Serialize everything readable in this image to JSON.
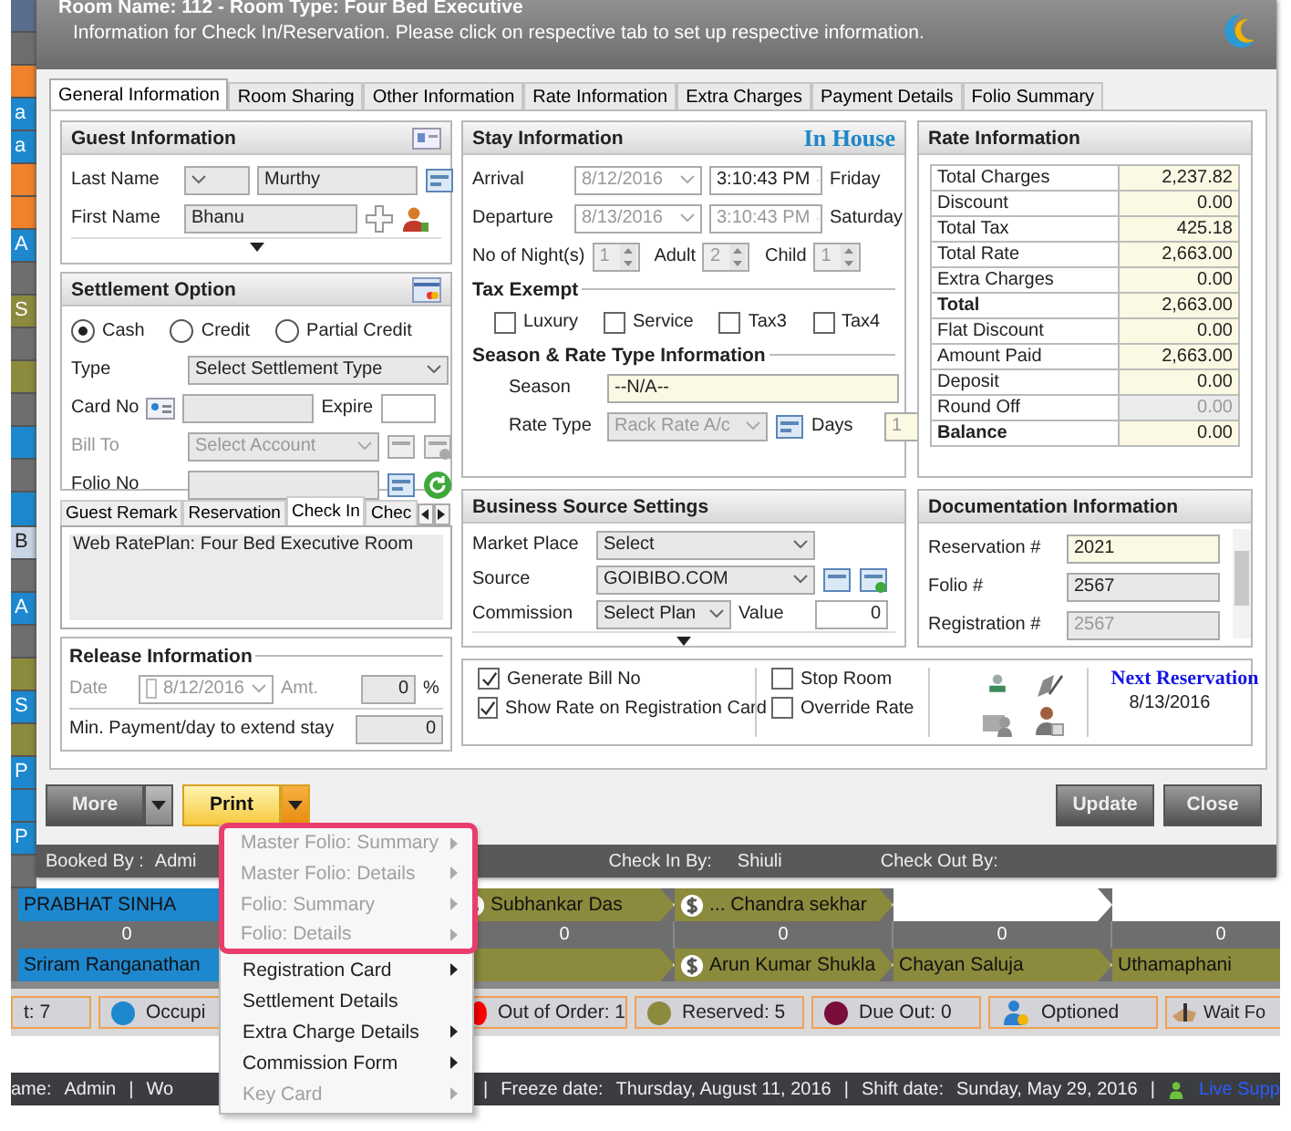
{
  "window": {
    "title": "Room Name: 112 - Room Type: Four Bed Executive",
    "subtitle": "Information for Check In/Reservation. Please click on respective tab to set up respective information."
  },
  "tabs": [
    {
      "label": "General Information",
      "selected": true
    },
    {
      "label": "Room Sharing",
      "selected": false
    },
    {
      "label": "Other Information",
      "selected": false
    },
    {
      "label": "Rate Information",
      "selected": false
    },
    {
      "label": "Extra Charges",
      "selected": false
    },
    {
      "label": "Payment Details",
      "selected": false
    },
    {
      "label": "Folio Summary",
      "selected": false
    }
  ],
  "guest": {
    "title": "Guest Information",
    "last_name_label": "Last Name",
    "last_name": "Murthy",
    "first_name_label": "First Name",
    "first_name": "Bhanu"
  },
  "settlement": {
    "title": "Settlement Option",
    "modes": [
      {
        "label": "Cash",
        "selected": true
      },
      {
        "label": "Credit",
        "selected": false
      },
      {
        "label": "Partial Credit",
        "selected": false
      }
    ],
    "type_label": "Type",
    "type_value": "Select Settlement Type",
    "card_label": "Card No",
    "expire_label": "Expire",
    "bill_to_label": "Bill To",
    "bill_to_value": "Select Account",
    "bill_to_disabled": true,
    "folio_label": "Folio No"
  },
  "remarks": {
    "tabs": [
      {
        "label": "Guest Remark",
        "selected": false
      },
      {
        "label": "Reservation",
        "selected": false
      },
      {
        "label": "Check In",
        "selected": true
      },
      {
        "label": "Chec",
        "selected": false
      }
    ],
    "text": "Web RatePlan: Four Bed Executive Room"
  },
  "release": {
    "title": "Release Information",
    "date_label": "Date",
    "date": "8/12/2016",
    "amount_label": "Amt.",
    "amount": "0",
    "percent": "%",
    "min_payment_label": "Min. Payment/day to extend stay",
    "min_payment": "0"
  },
  "stay": {
    "title": "Stay Information",
    "status": "In House",
    "dates": [
      {
        "label": "Arrival",
        "date": "8/12/2016",
        "time": "3:10:43 PM",
        "time_disabled": false,
        "day": "Friday"
      },
      {
        "label": "Departure",
        "date": "8/13/2016",
        "time": "3:10:43 PM",
        "time_disabled": true,
        "day": "Saturday"
      }
    ],
    "counts": [
      {
        "label": "No of Night(s)",
        "value": "1"
      },
      {
        "label": "Adult",
        "value": "2"
      },
      {
        "label": "Child",
        "value": "1"
      }
    ],
    "tax_title": "Tax Exempt",
    "taxes": [
      {
        "label": "Luxury",
        "checked": false
      },
      {
        "label": "Service",
        "checked": false
      },
      {
        "label": "Tax3",
        "checked": false
      },
      {
        "label": "Tax4",
        "checked": false
      }
    ],
    "season_title": "Season & Rate Type Information",
    "season_label": "Season",
    "season": "--N/A--",
    "rate_type_label": "Rate Type",
    "rate_type": "Rack Rate A/c",
    "days_label": "Days",
    "days": "1"
  },
  "rates": {
    "title": "Rate Information",
    "rows": [
      {
        "label": "Total Charges",
        "value": "2,237.82",
        "kind": "item"
      },
      {
        "label": "Discount",
        "value": "0.00",
        "kind": "item"
      },
      {
        "label": "Total Tax",
        "value": "425.18",
        "kind": "item"
      },
      {
        "label": "Total Rate",
        "value": "2,663.00",
        "kind": "item"
      },
      {
        "label": "Extra Charges",
        "value": "0.00",
        "kind": "item"
      },
      {
        "label": "Total",
        "value": "2,663.00",
        "kind": "total"
      },
      {
        "label": "Flat Discount",
        "value": "0.00",
        "kind": "item"
      },
      {
        "label": "Amount Paid",
        "value": "2,663.00",
        "kind": "item"
      },
      {
        "label": "Deposit",
        "value": "0.00",
        "kind": "item"
      },
      {
        "label": "Round Off",
        "value": "0.00",
        "kind": "readonly"
      },
      {
        "label": "Balance",
        "value": "0.00",
        "kind": "total"
      }
    ]
  },
  "business": {
    "title": "Business Source Settings",
    "market_label": "Market Place",
    "market": "Select",
    "source_label": "Source",
    "source": "GOIBIBO.COM",
    "commission_label": "Commission",
    "commission": "Select Plan",
    "value_label": "Value",
    "value": "0"
  },
  "documentation": {
    "title": "Documentation Information",
    "rows": [
      {
        "label": "Reservation #",
        "value": "2021",
        "disabled": false
      },
      {
        "label": "Folio #",
        "value": "2567",
        "disabled": false
      },
      {
        "label": "Registration #",
        "value": "2567",
        "disabled": true
      }
    ]
  },
  "options": [
    {
      "label": "Generate Bill No",
      "checked": true
    },
    {
      "label": "Show Rate on Registration Card",
      "checked": true
    },
    {
      "label": "Stop Room",
      "checked": false
    },
    {
      "label": "Override Rate",
      "checked": false
    }
  ],
  "next_reservation": {
    "title": "Next Reservation",
    "date": "8/13/2016"
  },
  "buttons": {
    "more": "More",
    "print": "Print",
    "update": "Update",
    "close": "Close"
  },
  "booking_bar": [
    {
      "label": "Booked By :",
      "value": "Admi"
    },
    {
      "label": "Check In By:",
      "value": "Shiuli"
    },
    {
      "label": "Check Out By:"
    }
  ],
  "print_menu": [
    {
      "label": "Master Folio: Summary",
      "disabled": true,
      "submenu": true,
      "callout": true
    },
    {
      "label": "Master Folio: Details",
      "disabled": true,
      "submenu": true,
      "callout": true
    },
    {
      "label": "Folio: Summary",
      "disabled": true,
      "submenu": true,
      "callout": true
    },
    {
      "label": "Folio: Details",
      "disabled": true,
      "submenu": true,
      "callout": true
    },
    {
      "label": "Registration Card",
      "disabled": false,
      "submenu": true,
      "callout": false
    },
    {
      "label": "Settlement Details",
      "disabled": false,
      "submenu": false,
      "callout": false
    },
    {
      "label": "Extra Charge Details",
      "disabled": false,
      "submenu": true,
      "callout": false
    },
    {
      "label": "Commission Form",
      "disabled": false,
      "submenu": true,
      "callout": false
    },
    {
      "label": "Key Card",
      "disabled": true,
      "submenu": true,
      "callout": false
    }
  ],
  "strip": [
    {
      "color": "#5b6d8c"
    },
    {
      "color": "#6e6e6e"
    },
    {
      "color": "#f0822e"
    },
    {
      "color": "#1e88cf",
      "text": "a"
    },
    {
      "color": "#1e88cf",
      "text": "a"
    },
    {
      "color": "#f0822e"
    },
    {
      "color": "#f0822e"
    },
    {
      "color": "#1e88cf",
      "text": "A"
    },
    {
      "color": "#6e6e6e"
    },
    {
      "color": "#8c8a3c",
      "text": "S"
    },
    {
      "color": "#6e6e6e"
    },
    {
      "color": "#8c8a3c"
    },
    {
      "color": "#6e6e6e"
    },
    {
      "color": "#1e88cf"
    },
    {
      "color": "#6e6e6e"
    },
    {
      "color": "#1e88cf"
    },
    {
      "color": "#c9d4e4",
      "text": "B"
    },
    {
      "color": "#6e6e6e"
    },
    {
      "color": "#1e88cf",
      "text": "A"
    },
    {
      "color": "#6e6e6e"
    },
    {
      "color": "#8c8a3c"
    },
    {
      "color": "#1e88cf",
      "text": "S"
    },
    {
      "color": "#8c8a3c"
    },
    {
      "color": "#1e88cf",
      "text": "P"
    },
    {
      "color": "#1e88cf"
    },
    {
      "color": "#1e88cf",
      "text": "P"
    },
    {
      "color": "#6e6e6e"
    }
  ],
  "grid": [
    {
      "kind": "names",
      "cells": [
        {
          "color": "#1e88cf",
          "text": "PRABHAT SINHA",
          "paid": false
        },
        {},
        {
          "color": "#8c8a3c",
          "text": "Subhankar Das",
          "paid": true
        },
        {
          "color": "#8c8a3c",
          "text": "... Chandra sekhar",
          "paid": true
        },
        {
          "color": "#ffffff",
          "paid": false
        },
        {
          "color": "#ffffff",
          "paid": false
        }
      ]
    },
    {
      "kind": "counts",
      "cells": [
        {
          "text": "0"
        },
        {},
        {
          "text": "0"
        },
        {
          "text": "0"
        },
        {
          "text": "0"
        },
        {
          "text": "0"
        }
      ]
    },
    {
      "kind": "names",
      "cells": [
        {
          "color": "#1e88cf",
          "text": "Sriram Ranganathan",
          "paid": false
        },
        {},
        {
          "color": "#8c8a3c",
          "paid": false
        },
        {
          "color": "#8c8a3c",
          "text": "Arun Kumar Shukla",
          "paid": true
        },
        {
          "color": "#8c8a3c",
          "text": "Chayan Saluja",
          "paid": false
        },
        {
          "color": "#8c8a3c",
          "text": "Uthamaphani",
          "paid": false
        }
      ]
    }
  ],
  "legend": [
    {
      "kind": "text",
      "text": "t: 7"
    },
    {
      "kind": "dot",
      "color": "#1e88cf",
      "text": "Occupi"
    },
    {
      "kind": "dot",
      "color": "#ff0000",
      "text": "Out of Order: 1"
    },
    {
      "kind": "dot",
      "color": "#8c8a3c",
      "text": "Reserved: 5"
    },
    {
      "kind": "dot",
      "color": "#7a0d3c",
      "text": "Due Out: 0"
    },
    {
      "kind": "person",
      "text": "Optioned"
    },
    {
      "kind": "wait",
      "text": "Wait Fo"
    }
  ],
  "status_bar": [
    {
      "kind": "label",
      "text": "ame:"
    },
    {
      "kind": "value",
      "text": "Admin"
    },
    {
      "kind": "separator",
      "text": "|"
    },
    {
      "kind": "label",
      "text": "Wo"
    },
    {
      "kind": "separator",
      "text": "|"
    },
    {
      "kind": "label",
      "text": "Freeze date:"
    },
    {
      "kind": "value",
      "text": "Thursday, August 11, 2016"
    },
    {
      "kind": "separator",
      "text": "|"
    },
    {
      "kind": "label",
      "text": "Shift date:"
    },
    {
      "kind": "value",
      "text": "Sunday, May 29, 2016"
    },
    {
      "kind": "separator",
      "text": "|"
    },
    {
      "kind": "link",
      "text": "Live Supp"
    }
  ]
}
